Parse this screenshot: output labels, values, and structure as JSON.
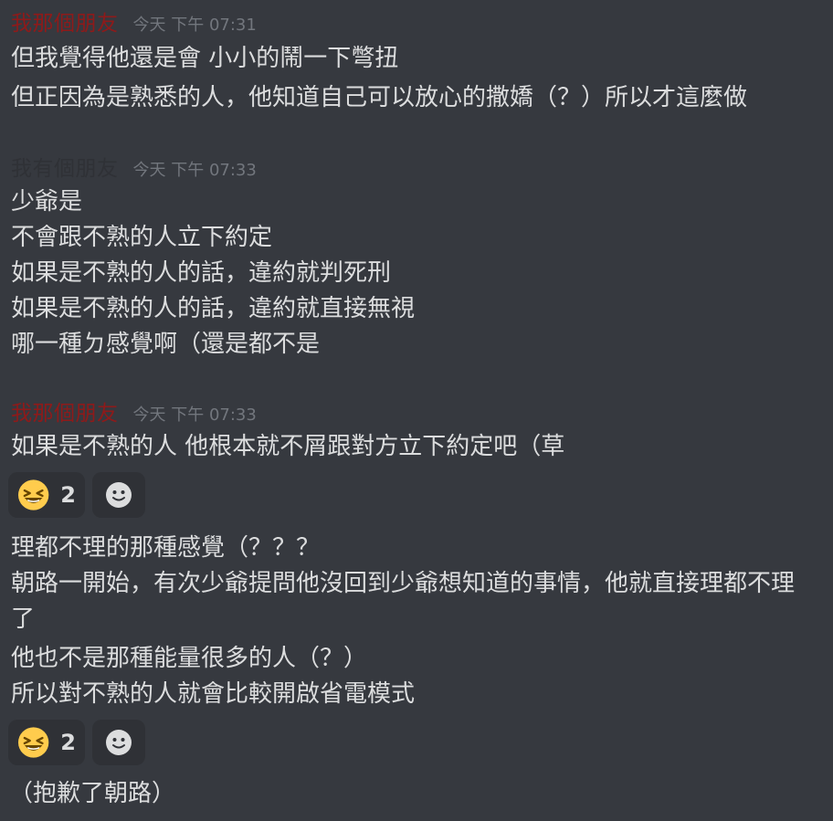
{
  "colors": {
    "background": "#36393f",
    "text": "#dcddde",
    "timestamp": "#72767d",
    "reaction_bg": "#2f3136",
    "username_red": "#8e1a1a",
    "username_gray": "#2f3136"
  },
  "groups": [
    {
      "username": "我那個朋友",
      "timestamp": "今天 下午 07:31",
      "messages": [
        "但我覺得他還是會 小小的鬧一下彆扭",
        "但正因為是熟悉的人，他知道自己可以放心的撒嬌（？）所以才這麼做"
      ]
    },
    {
      "username": "我有個朋友",
      "timestamp": "今天 下午 07:33",
      "messages": [
        "少爺是\n不會跟不熟的人立下約定\n如果是不熟的人的話，違約就判死刑\n如果是不熟的人的話，違約就直接無視\n哪一種ㄉ感覺啊（還是都不是"
      ]
    },
    {
      "username": "我那個朋友",
      "timestamp": "今天 下午 07:33",
      "messages": [
        "如果是不熟的人 他根本就不屑跟對方立下約定吧（草"
      ],
      "reaction1": {
        "emoji": "laughing-face",
        "count": "2"
      },
      "messages2": [
        "理都不理的那種感覺（？？？\n朝路一開始，有次少爺提問他沒回到少爺想知道的事情，他就直接理都不理了",
        "他也不是那種能量很多的人（？）\n所以對不熟的人就會比較開啟省電模式"
      ],
      "reaction2": {
        "emoji": "laughing-face",
        "count": "2"
      },
      "messages3": [
        "（抱歉了朝路）"
      ]
    }
  ]
}
